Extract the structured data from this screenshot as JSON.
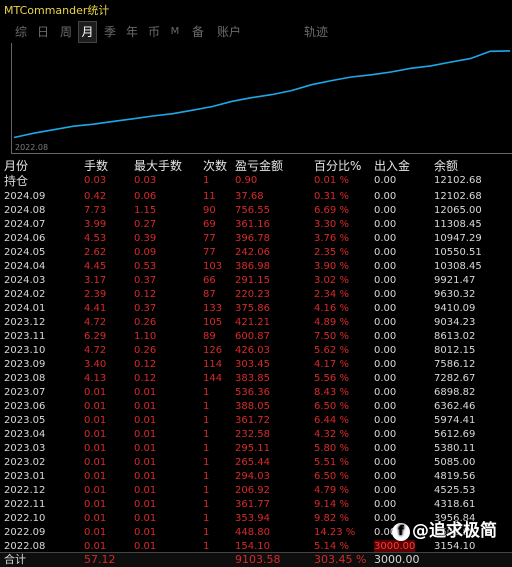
{
  "window": {
    "title": "MTCommander统计"
  },
  "tabs": [
    {
      "label": "综",
      "active": false
    },
    {
      "label": "日",
      "active": false
    },
    {
      "label": "周",
      "active": false
    },
    {
      "label": "月",
      "active": true
    },
    {
      "label": "季",
      "active": false
    },
    {
      "label": "年",
      "active": false
    },
    {
      "label": "币",
      "active": false
    },
    {
      "label": "M",
      "active": false
    },
    {
      "label": "备",
      "active": false
    },
    {
      "label": "账户",
      "active": false
    },
    {
      "label": "轨迹",
      "active": false
    }
  ],
  "chart_data": {
    "type": "line",
    "x_start_label": "2022.08",
    "x": [
      "2022.08",
      "2022.09",
      "2022.10",
      "2022.11",
      "2022.12",
      "2023.01",
      "2023.02",
      "2023.03",
      "2023.04",
      "2023.05",
      "2023.06",
      "2023.07",
      "2023.08",
      "2023.09",
      "2023.10",
      "2023.11",
      "2023.12",
      "2024.01",
      "2024.02",
      "2024.03",
      "2024.04",
      "2024.05",
      "2024.06",
      "2024.07",
      "2024.08",
      "2024.09"
    ],
    "values": [
      3154.1,
      3602.9,
      3956.84,
      4318.61,
      4525.53,
      4819.56,
      5085.0,
      5380.11,
      5612.69,
      5974.41,
      6362.46,
      6898.82,
      7282.67,
      7586.12,
      8012.15,
      8613.02,
      9034.23,
      9410.09,
      9630.32,
      9921.47,
      10308.45,
      10550.51,
      10947.29,
      11308.45,
      12065.0,
      12102.68
    ],
    "line_color": "#1ea8e8"
  },
  "table": {
    "headers": [
      "月份",
      "手数",
      "最大手数",
      "次数",
      "盈亏金额",
      "百分比%",
      "出入金",
      "余额"
    ],
    "rows": [
      [
        "持仓",
        "0.03",
        "0.03",
        "1",
        "0.90",
        "0.01 %",
        "0.00",
        "12102.68"
      ],
      [
        "2024.09",
        "0.42",
        "0.06",
        "11",
        "37.68",
        "0.31 %",
        "0.00",
        "12102.68"
      ],
      [
        "2024.08",
        "7.73",
        "1.15",
        "90",
        "756.55",
        "6.69 %",
        "0.00",
        "12065.00"
      ],
      [
        "2024.07",
        "3.99",
        "0.27",
        "69",
        "361.16",
        "3.30 %",
        "0.00",
        "11308.45"
      ],
      [
        "2024.06",
        "4.53",
        "0.39",
        "77",
        "396.78",
        "3.76 %",
        "0.00",
        "10947.29"
      ],
      [
        "2024.05",
        "2.62",
        "0.09",
        "77",
        "242.06",
        "2.35 %",
        "0.00",
        "10550.51"
      ],
      [
        "2024.04",
        "4.45",
        "0.53",
        "103",
        "386.98",
        "3.90 %",
        "0.00",
        "10308.45"
      ],
      [
        "2024.03",
        "3.17",
        "0.37",
        "66",
        "291.15",
        "3.02 %",
        "0.00",
        "9921.47"
      ],
      [
        "2024.02",
        "2.39",
        "0.12",
        "87",
        "220.23",
        "2.34 %",
        "0.00",
        "9630.32"
      ],
      [
        "2024.01",
        "4.41",
        "0.37",
        "133",
        "375.86",
        "4.16 %",
        "0.00",
        "9410.09"
      ],
      [
        "2023.12",
        "4.72",
        "0.26",
        "105",
        "421.21",
        "4.89 %",
        "0.00",
        "9034.23"
      ],
      [
        "2023.11",
        "6.29",
        "1.10",
        "89",
        "600.87",
        "7.50 %",
        "0.00",
        "8613.02"
      ],
      [
        "2023.10",
        "4.72",
        "0.26",
        "126",
        "426.03",
        "5.62 %",
        "0.00",
        "8012.15"
      ],
      [
        "2023.09",
        "3.40",
        "0.12",
        "114",
        "303.45",
        "4.17 %",
        "0.00",
        "7586.12"
      ],
      [
        "2023.08",
        "4.13",
        "0.12",
        "144",
        "383.85",
        "5.56 %",
        "0.00",
        "7282.67"
      ],
      [
        "2023.07",
        "0.01",
        "0.01",
        "1",
        "536.36",
        "8.43 %",
        "0.00",
        "6898.82"
      ],
      [
        "2023.06",
        "0.01",
        "0.01",
        "1",
        "388.05",
        "6.50 %",
        "0.00",
        "6362.46"
      ],
      [
        "2023.05",
        "0.01",
        "0.01",
        "1",
        "361.72",
        "6.44 %",
        "0.00",
        "5974.41"
      ],
      [
        "2023.04",
        "0.01",
        "0.01",
        "1",
        "232.58",
        "4.32 %",
        "0.00",
        "5612.69"
      ],
      [
        "2023.03",
        "0.01",
        "0.01",
        "1",
        "295.11",
        "5.80 %",
        "0.00",
        "5380.11"
      ],
      [
        "2023.02",
        "0.01",
        "0.01",
        "1",
        "265.44",
        "5.51 %",
        "0.00",
        "5085.00"
      ],
      [
        "2023.01",
        "0.01",
        "0.01",
        "1",
        "294.03",
        "6.50 %",
        "0.00",
        "4819.56"
      ],
      [
        "2022.12",
        "0.01",
        "0.01",
        "1",
        "206.92",
        "4.79 %",
        "0.00",
        "4525.53"
      ],
      [
        "2022.11",
        "0.01",
        "0.01",
        "1",
        "361.77",
        "9.14 %",
        "0.00",
        "4318.61"
      ],
      [
        "2022.10",
        "0.01",
        "0.01",
        "1",
        "353.94",
        "9.82 %",
        "0.00",
        "3956.84"
      ],
      [
        "2022.09",
        "0.01",
        "0.01",
        "1",
        "448.80",
        "14.23 %",
        "0.00",
        "3602.90"
      ],
      [
        "2022.08",
        "0.01",
        "0.01",
        "1",
        "154.10",
        "5.14 %",
        "3000.00",
        "3154.10"
      ]
    ],
    "total": [
      "合计",
      "57.12",
      "",
      "",
      "9103.58",
      "303.45 %",
      "3000.00",
      ""
    ]
  },
  "watermark": {
    "icon": "f",
    "text": "@追求极简"
  }
}
